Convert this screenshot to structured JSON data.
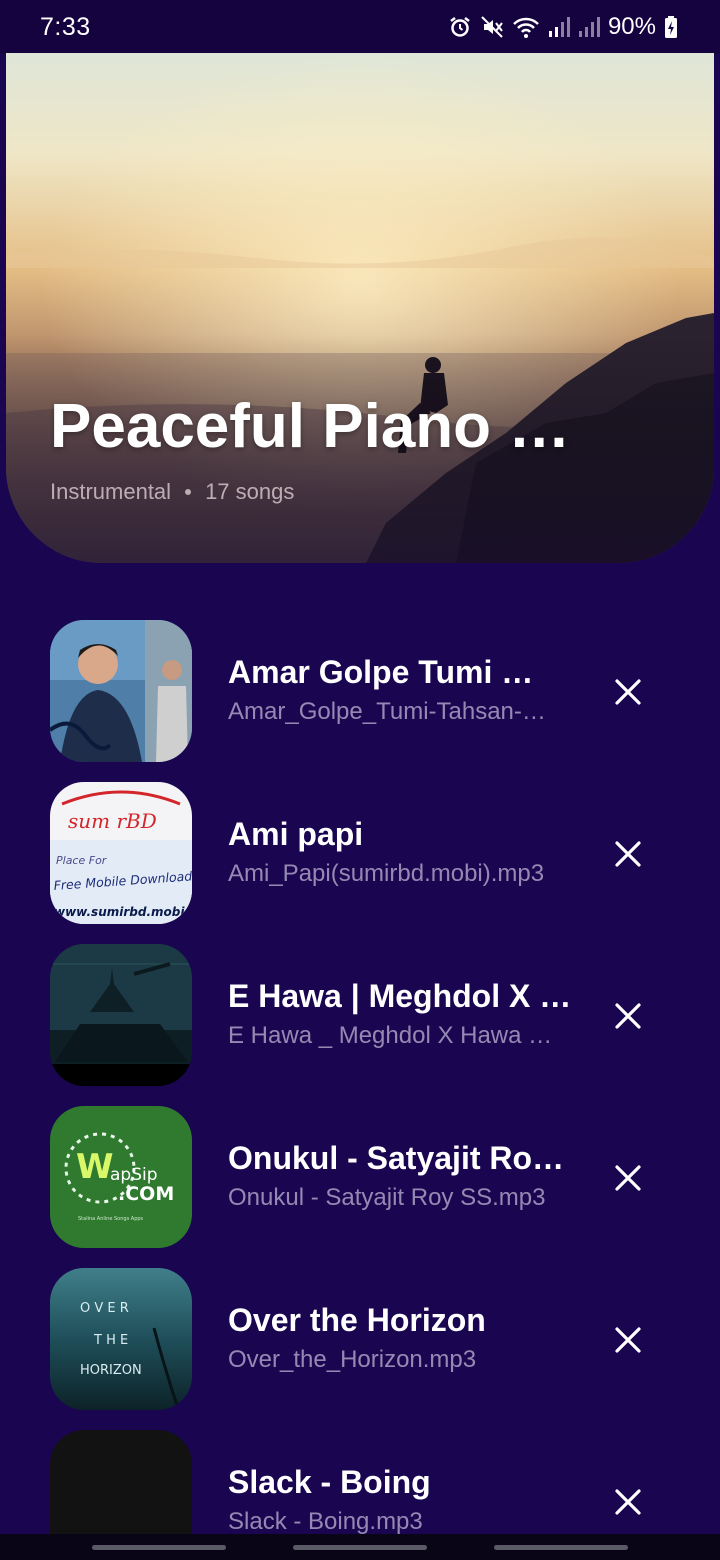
{
  "status_bar": {
    "time": "7:33",
    "battery": "90%",
    "icons": [
      "alarm-icon",
      "mute-icon",
      "wifi-icon",
      "signal-icon",
      "signal-icon",
      "battery-icon"
    ]
  },
  "playlist": {
    "title": "Peaceful Piano …",
    "category": "Instrumental",
    "song_count": "17 songs"
  },
  "songs": [
    {
      "title": "Amar Golpe Tumi …",
      "file": "Amar_Golpe_Tumi-Tahsan-…"
    },
    {
      "title": "Ami papi",
      "file": "Ami_Papi(sumirbd.mobi).mp3"
    },
    {
      "title": "E Hawa | Meghdol X …",
      "file": "E Hawa _ Meghdol X Hawa …"
    },
    {
      "title": "Onukul - Satyajit Ro…",
      "file": "Onukul - Satyajit Roy SS.mp3"
    },
    {
      "title": "Over the Horizon",
      "file": "Over_the_Horizon.mp3"
    },
    {
      "title": "Slack - Boing",
      "file": "Slack - Boing.mp3"
    }
  ],
  "thumb_text": {
    "sumir_logo": "sum rBD",
    "sumir_place": "Place For",
    "sumir_free": "Free Mobile Downloads",
    "sumir_url": "www.sumirbd.mobi",
    "wapsip_w": "W",
    "wapsip_name": "apSip",
    "wapsip_com": ".COM",
    "wapsip_tag": "Stalina Anline Songs Apps",
    "horizon_1": "O V E R",
    "horizon_2": "T H E",
    "horizon_3": "HORIZON"
  },
  "colors": {
    "background": "#1a0550",
    "status_bar": "#150340",
    "text_primary": "#ffffff",
    "text_secondary": "#cdc8e1"
  }
}
